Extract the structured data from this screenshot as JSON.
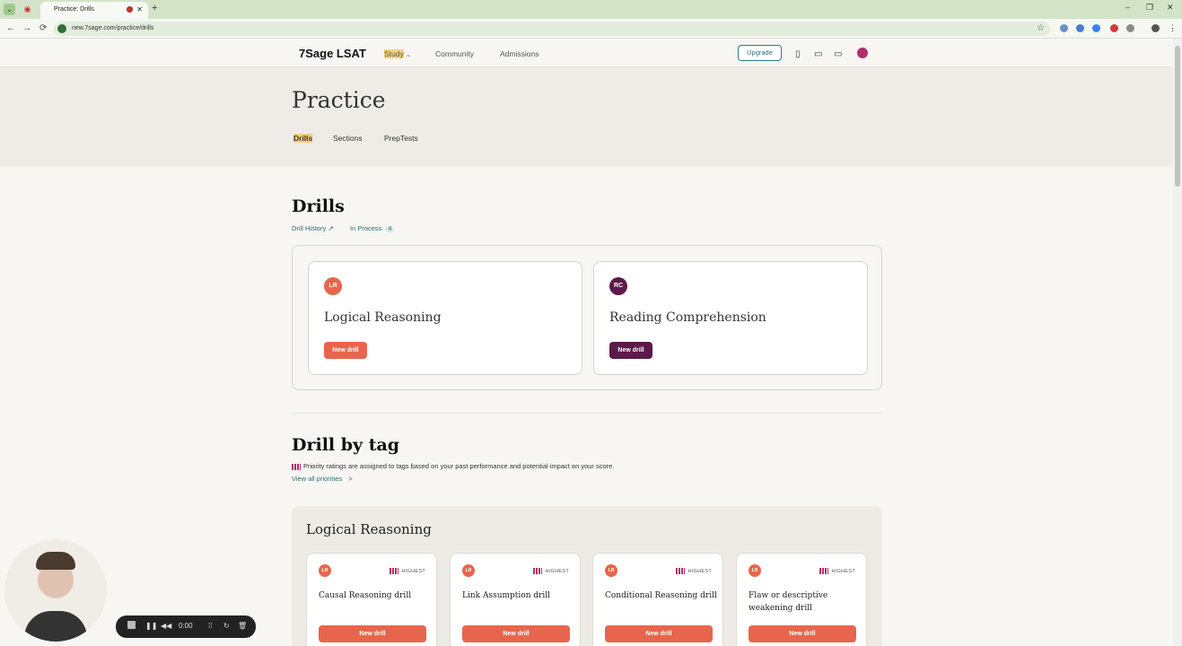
{
  "browser": {
    "tab_title": "Practice: Drills",
    "url": "new.7sage.com/practice/drills",
    "new_tab": "+",
    "window_controls": [
      "–",
      "❐",
      "✕"
    ],
    "nav": [
      "←",
      "→",
      "⟳"
    ]
  },
  "header": {
    "logo": "7Sage LSAT",
    "nav": [
      {
        "label": "Study",
        "active": true,
        "dropdown": "⌄"
      },
      {
        "label": "Community"
      },
      {
        "label": "Admissions"
      }
    ],
    "upgrade_label": "Upgrade"
  },
  "hero": {
    "title": "Practice",
    "tabs": [
      {
        "label": "Drills",
        "active": true
      },
      {
        "label": "Sections"
      },
      {
        "label": "PrepTests"
      }
    ]
  },
  "drills": {
    "title": "Drills",
    "history_link": "Drill History",
    "history_arrow": "↗",
    "in_process_label": "In Process",
    "in_process_count": "4",
    "cards": [
      {
        "abbr": "LR",
        "title": "Logical Reasoning",
        "button": "New drill",
        "color": "#e8654d"
      },
      {
        "abbr": "RC",
        "title": "Reading Comprehension",
        "button": "New drill",
        "color": "#5c1a4a"
      }
    ]
  },
  "drill_by_tag": {
    "title": "Drill by tag",
    "priority_note": "Priority ratings are assigned to tags based on your past performance and potential impact on your score.",
    "view_all": "View all priorities",
    "view_all_chevron": ">",
    "section": "Logical Reasoning",
    "cards": [
      {
        "abbr": "LR",
        "priority": "HIGHEST",
        "name": "Causal Reasoning drill",
        "button": "New drill"
      },
      {
        "abbr": "LR",
        "priority": "HIGHEST",
        "name": "Link Assumption drill",
        "button": "New drill"
      },
      {
        "abbr": "LR",
        "priority": "HIGHEST",
        "name": "Conditional Reasoning drill",
        "button": "New drill"
      },
      {
        "abbr": "LR",
        "priority": "HIGHEST",
        "name": "Flaw or descriptive weakening drill",
        "button": "New drill"
      }
    ]
  },
  "recorder": {
    "time": "0:00"
  }
}
